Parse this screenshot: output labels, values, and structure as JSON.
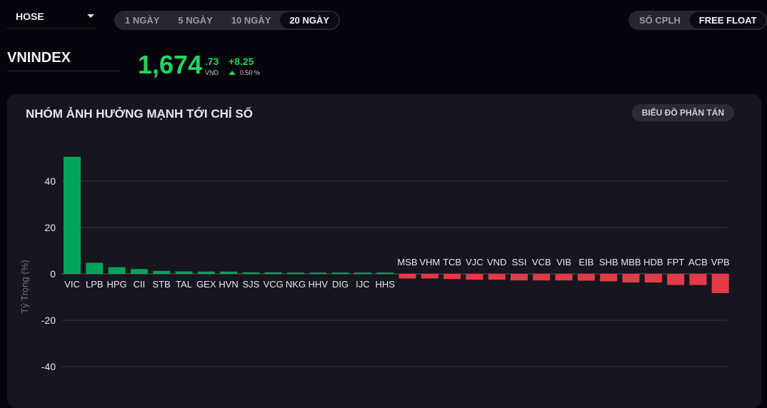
{
  "toolbar": {
    "exchange": "HOSE",
    "periods": [
      "1 NGÀY",
      "5 NGÀY",
      "10 NGÀY",
      "20 NGÀY"
    ],
    "active_period": "20 NGÀY",
    "modes": [
      "SỐ CPLH",
      "FREE FLOAT"
    ],
    "active_mode": "FREE FLOAT"
  },
  "index": {
    "name": "VNINDEX",
    "price_main": "1,674",
    "price_decimal": ".73",
    "unit": "VND",
    "change": "+8.25",
    "change_pct": "0.50 %"
  },
  "panel": {
    "title": "NHÓM ẢNH HƯỞNG MẠNH TỚI CHỈ SỐ",
    "scatter_button": "BIỂU ĐỒ PHÂN TÁN"
  },
  "colors": {
    "positive": "#00a35a",
    "negative": "#e63946",
    "accent": "#1fd65f"
  },
  "chart_data": {
    "type": "bar",
    "ylabel": "Tỷ Trọng (%)",
    "yticks": [
      40,
      20,
      0,
      -20,
      -40
    ],
    "ylim": [
      -45,
      51
    ],
    "categories": [
      "VIC",
      "LPB",
      "HPG",
      "CII",
      "STB",
      "TAL",
      "GEX",
      "HVN",
      "SJS",
      "VCG",
      "NKG",
      "HHV",
      "DIG",
      "IJC",
      "HHS",
      "MSB",
      "VHM",
      "TCB",
      "VJC",
      "VND",
      "SSI",
      "VCB",
      "VIB",
      "EIB",
      "SHB",
      "MBB",
      "HDB",
      "FPT",
      "ACB",
      "VPB"
    ],
    "values": [
      50.5,
      4.8,
      2.9,
      2.1,
      1.3,
      1.1,
      1.0,
      1.0,
      0.7,
      0.7,
      0.6,
      0.6,
      0.6,
      0.6,
      0.6,
      -2.0,
      -2.0,
      -2.2,
      -2.5,
      -2.5,
      -2.8,
      -2.8,
      -2.8,
      -2.9,
      -3.2,
      -3.7,
      -3.7,
      -4.8,
      -4.8,
      -8.3
    ]
  }
}
